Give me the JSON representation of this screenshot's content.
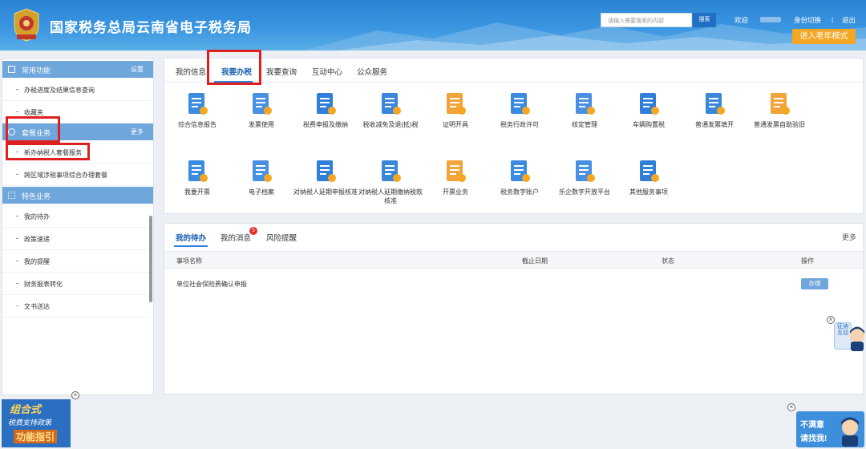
{
  "header": {
    "title": "国家税务总局云南省电子税务局",
    "search_placeholder": "请输入需要搜索的内容",
    "search_button": "搜索",
    "welcome": "欢迎",
    "identity_switch": "身份切换",
    "separator": "|",
    "logout": "退出",
    "elder_mode": "进入老年模式"
  },
  "sidebar": {
    "sections": [
      {
        "label": "常用功能",
        "action": "设置",
        "items": [
          "办税进度及结果信息查询",
          "收藏夹"
        ]
      },
      {
        "label": "套餐业务",
        "action": "更多",
        "items": [
          "新办纳税人套餐服务",
          "跨区域涉税事项综合办理套餐"
        ]
      },
      {
        "label": "特色业务",
        "action": "",
        "items": [
          "我的待办",
          "政策速递",
          "我的提醒",
          "财务报表转化",
          "文书送达"
        ]
      }
    ]
  },
  "main": {
    "tabs": [
      "我的信息",
      "我要办税",
      "我要查询",
      "互动中心",
      "公众服务"
    ],
    "active_tab": "我要办税",
    "services": [
      {
        "label": "综合信息报告",
        "icon": "info-report-icon"
      },
      {
        "label": "发票使用",
        "icon": "invoice-printer-icon"
      },
      {
        "label": "税费申报及缴纳",
        "icon": "tax-declare-icon"
      },
      {
        "label": "税收减免及退(抵)税",
        "icon": "tax-reduction-icon"
      },
      {
        "label": "证明开具",
        "icon": "certificate-icon"
      },
      {
        "label": "税务行政许可",
        "icon": "admin-license-icon"
      },
      {
        "label": "核定管理",
        "icon": "assessment-icon"
      },
      {
        "label": "车辆购置税",
        "icon": "vehicle-tax-icon"
      },
      {
        "label": "普通发票填开",
        "icon": "invoice-fill-icon"
      },
      {
        "label": "普通发票自助验旧",
        "icon": "invoice-verify-icon"
      },
      {
        "label": "我要开票",
        "icon": "issue-invoice-icon"
      },
      {
        "label": "电子档案",
        "icon": "e-archive-icon"
      },
      {
        "label": "对纳税人延期申报核准",
        "icon": "extension-declare-icon"
      },
      {
        "label": "对纳税人延期缴纳税款核准",
        "icon": "extension-payment-icon"
      },
      {
        "label": "开票业务",
        "icon": "invoicing-business-icon"
      },
      {
        "label": "税务数字账户",
        "icon": "digital-account-icon"
      },
      {
        "label": "乐企数字开放平台",
        "icon": "open-platform-icon"
      },
      {
        "label": "其他服务事项",
        "icon": "other-services-icon"
      }
    ]
  },
  "todo": {
    "tabs": [
      "我的待办",
      "我的消息",
      "风险提醒"
    ],
    "message_badge": "5",
    "more": "更多",
    "columns": [
      "事项名称",
      "截止日期",
      "状态",
      "操作"
    ],
    "rows": [
      {
        "name": "单位社会保险费确认申报",
        "deadline": "",
        "status": "",
        "action": "办理"
      }
    ]
  },
  "widgets": {
    "close_symbol": "×",
    "promo_left": {
      "line1": "组合式",
      "line2": "税费支持政策",
      "line3": "功能指引"
    },
    "promo_right": {
      "line1": "不满意",
      "line2": "请找我!"
    },
    "assistant": "征纳互动"
  },
  "colors": {
    "header_blue": "#3a95e0",
    "accent_blue": "#2f7ed8",
    "section_blue": "#6fa6dc",
    "elder_orange": "#f5a623",
    "highlight_red": "#e02020"
  }
}
